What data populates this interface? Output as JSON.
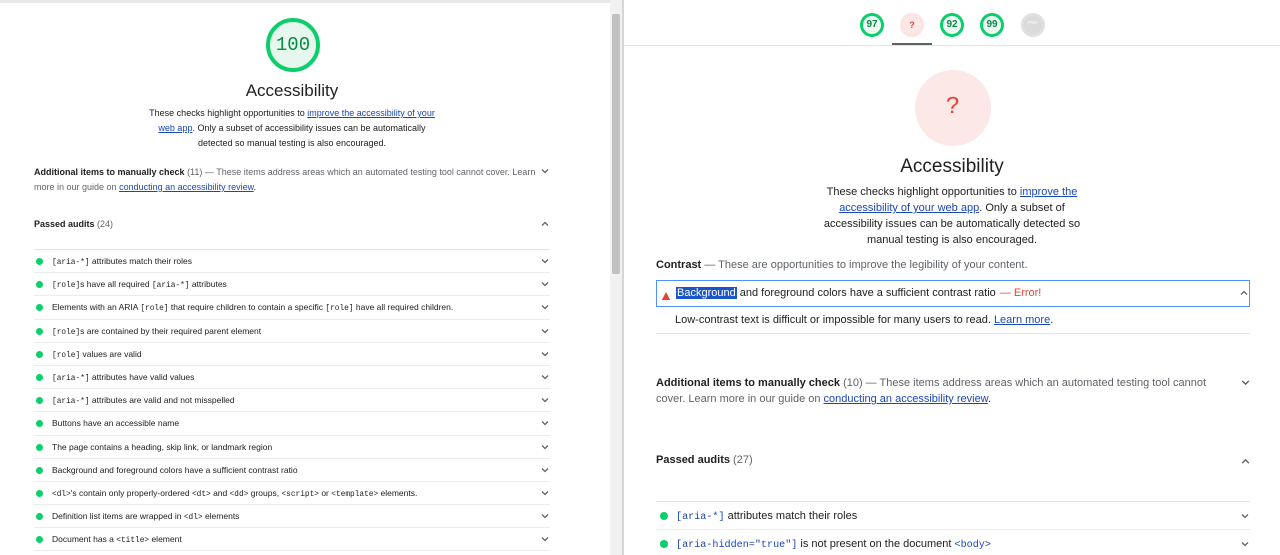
{
  "left": {
    "score": "100",
    "title": "Accessibility",
    "desc_pre": "These checks highlight opportunities to ",
    "desc_link": "improve the accessibility of your web app",
    "desc_post": ". Only a subset of accessibility issues can be automatically detected so manual testing is also encouraged.",
    "manual": {
      "title": "Additional items to manually check",
      "count": "(11)",
      "desc": " — These items address areas which an automated testing tool cannot cover. Learn more in our guide on ",
      "link": "conducting an accessibility review",
      "end": "."
    },
    "passed": {
      "title": "Passed audits",
      "count": "(24)"
    },
    "audits": [
      [
        {
          "c": "[aria-*]"
        },
        {
          "t": " attributes match their roles"
        }
      ],
      [
        {
          "c": "[role]"
        },
        {
          "t": "s have all required "
        },
        {
          "c": "[aria-*]"
        },
        {
          "t": " attributes"
        }
      ],
      [
        {
          "t": "Elements with an ARIA "
        },
        {
          "c": "[role]"
        },
        {
          "t": " that require children to contain a specific "
        },
        {
          "c": "[role]"
        },
        {
          "t": " have all required children."
        }
      ],
      [
        {
          "c": "[role]"
        },
        {
          "t": "s are contained by their required parent element"
        }
      ],
      [
        {
          "c": "[role]"
        },
        {
          "t": " values are valid"
        }
      ],
      [
        {
          "c": "[aria-*]"
        },
        {
          "t": " attributes have valid values"
        }
      ],
      [
        {
          "c": "[aria-*]"
        },
        {
          "t": " attributes are valid and not misspelled"
        }
      ],
      [
        {
          "t": "Buttons have an accessible name"
        }
      ],
      [
        {
          "t": "The page contains a heading, skip link, or landmark region"
        }
      ],
      [
        {
          "t": "Background and foreground colors have a sufficient contrast ratio"
        }
      ],
      [
        {
          "c": "<dl>"
        },
        {
          "t": "'s contain only properly-ordered "
        },
        {
          "c": "<dt>"
        },
        {
          "t": " and "
        },
        {
          "c": "<dd>"
        },
        {
          "t": " groups, "
        },
        {
          "c": "<script>"
        },
        {
          "t": " or "
        },
        {
          "c": "<template>"
        },
        {
          "t": " elements."
        }
      ],
      [
        {
          "t": "Definition list items are wrapped in "
        },
        {
          "c": "<dl>"
        },
        {
          "t": " elements"
        }
      ],
      [
        {
          "t": "Document has a "
        },
        {
          "c": "<title>"
        },
        {
          "t": " element"
        }
      ]
    ]
  },
  "right": {
    "nav": [
      {
        "label": "97",
        "kind": "green"
      },
      {
        "label": "?",
        "kind": "err"
      },
      {
        "label": "92",
        "kind": "green"
      },
      {
        "label": "99",
        "kind": "green"
      },
      {
        "label": "PWA",
        "kind": "gray"
      }
    ],
    "score": "?",
    "title": "Accessibility",
    "desc_pre": "These checks highlight opportunities to ",
    "desc_link": "improve the accessibility of your web app",
    "desc_post": ". Only a subset of accessibility issues can be automatically detected so manual testing is also encouraged.",
    "contrast": {
      "title": "Contrast",
      "desc": " — These are opportunities to improve the legibility of your content.",
      "audit_highlight": "Background",
      "audit_rest": " and foreground colors have a sufficient contrast ratio",
      "error": "— Error!",
      "detail": "Low-contrast text is difficult or impossible for many users to read. ",
      "detail_link": "Learn more",
      "detail_end": "."
    },
    "manual": {
      "title": "Additional items to manually check",
      "count": "(10)",
      "desc": " — These items address areas which an automated testing tool cannot cover. Learn more in our guide on ",
      "link": "conducting an accessibility review",
      "end": "."
    },
    "passed": {
      "title": "Passed audits",
      "count": "(27)"
    },
    "audits": [
      [
        {
          "c": "[aria-*]"
        },
        {
          "t": " attributes match their roles"
        }
      ],
      [
        {
          "c": "[aria-hidden=\"true\"]"
        },
        {
          "t": " is not present on the document "
        },
        {
          "c": "<body>"
        }
      ]
    ]
  },
  "colors": {
    "pass": "#0cce6b",
    "error": "#e44336",
    "link": "#1a47b8",
    "focus": "#4d90fe"
  }
}
